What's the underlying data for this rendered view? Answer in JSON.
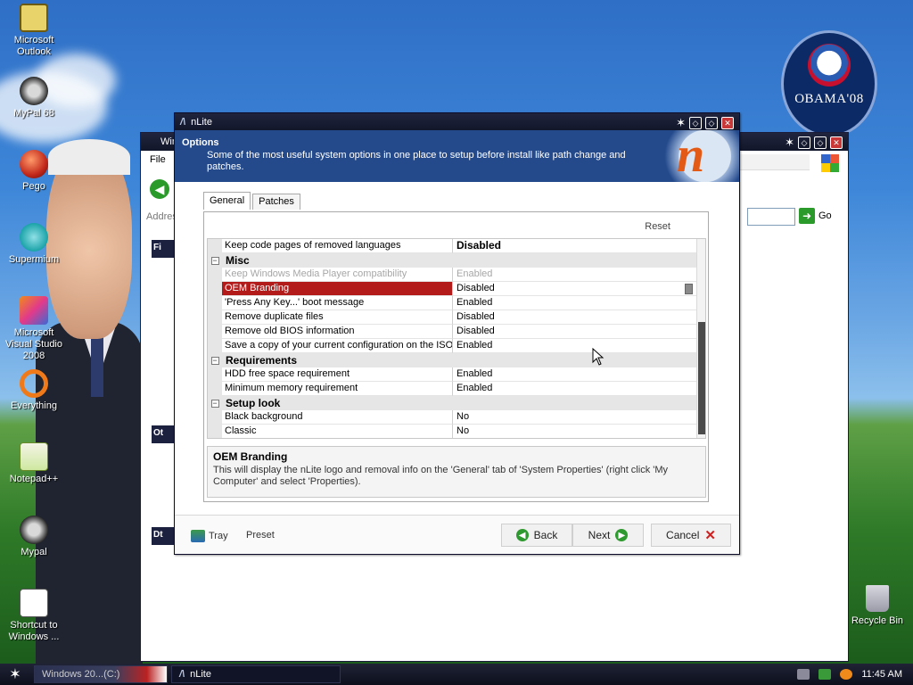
{
  "desktop": {
    "icons": [
      {
        "label": "Microsoft Outlook",
        "icon": "outlook-icon"
      },
      {
        "label": "MyPal 68",
        "icon": "mypal-icon"
      },
      {
        "label": "Pego",
        "icon": "pego-icon"
      },
      {
        "label": "Supermium",
        "icon": "supermium-icon"
      },
      {
        "label": "Microsoft Visual Studio 2008",
        "icon": "visual-studio-icon"
      },
      {
        "label": "Everything",
        "icon": "everything-icon"
      },
      {
        "label": "Notepad++",
        "icon": "notepadpp-icon"
      },
      {
        "label": "Mypal",
        "icon": "mypal-icon"
      },
      {
        "label": "Shortcut to Windows ...",
        "icon": "shortcut-icon"
      }
    ],
    "recycle_bin": "Recycle Bin",
    "obama_logo_text": "OBAMA'08"
  },
  "explorer": {
    "title": "Win",
    "menu_file": "File",
    "address_label": "Address",
    "go_label": "Go",
    "left_boxes": [
      "Fi",
      "Ot",
      "Dt"
    ]
  },
  "nlite": {
    "title": "nLite",
    "header": {
      "title": "Options",
      "description": "Some of the most useful system options in one place to setup before install like path change and patches."
    },
    "tabs": [
      {
        "label": "General",
        "active": true
      },
      {
        "label": "Patches",
        "active": false
      }
    ],
    "reset_label": "Reset",
    "rows": [
      {
        "type": "item",
        "name": "Keep code pages of removed languages",
        "value": "Disabled",
        "bold": true
      },
      {
        "type": "cat",
        "name": "Misc"
      },
      {
        "type": "item",
        "name": "Keep Windows Media Player compatibility",
        "value": "Enabled",
        "disabled": true
      },
      {
        "type": "item",
        "name": "OEM Branding",
        "value": "Disabled",
        "selected": true
      },
      {
        "type": "item",
        "name": "'Press Any Key...' boot message",
        "value": "Enabled"
      },
      {
        "type": "item",
        "name": "Remove duplicate files",
        "value": "Disabled"
      },
      {
        "type": "item",
        "name": "Remove old BIOS information",
        "value": "Disabled"
      },
      {
        "type": "item",
        "name": "Save a copy of your current configuration on the ISO",
        "value": "Enabled"
      },
      {
        "type": "cat",
        "name": "Requirements"
      },
      {
        "type": "item",
        "name": "HDD free space requirement",
        "value": "Enabled"
      },
      {
        "type": "item",
        "name": "Minimum memory requirement",
        "value": "Enabled"
      },
      {
        "type": "cat",
        "name": "Setup look"
      },
      {
        "type": "item",
        "name": "Black background",
        "value": "No"
      },
      {
        "type": "item",
        "name": "Classic",
        "value": "No"
      }
    ],
    "description_box": {
      "title": "OEM Branding",
      "text": "This will display the nLite logo and removal info on the 'General' tab of 'System Properties' (right click 'My Computer' and select 'Properties)."
    },
    "footer": {
      "tray": "Tray",
      "preset": "Preset",
      "back": "Back",
      "next": "Next",
      "cancel": "Cancel"
    }
  },
  "taskbar": {
    "items": [
      {
        "label": "Windows 20...(C:)"
      },
      {
        "label": "nLite"
      }
    ],
    "clock": "11:45 AM"
  },
  "colors": {
    "title_bar": "#12162a",
    "header_blue": "#244a8c",
    "selected_row": "#b31a1a",
    "green_button": "#2f9a2f"
  }
}
